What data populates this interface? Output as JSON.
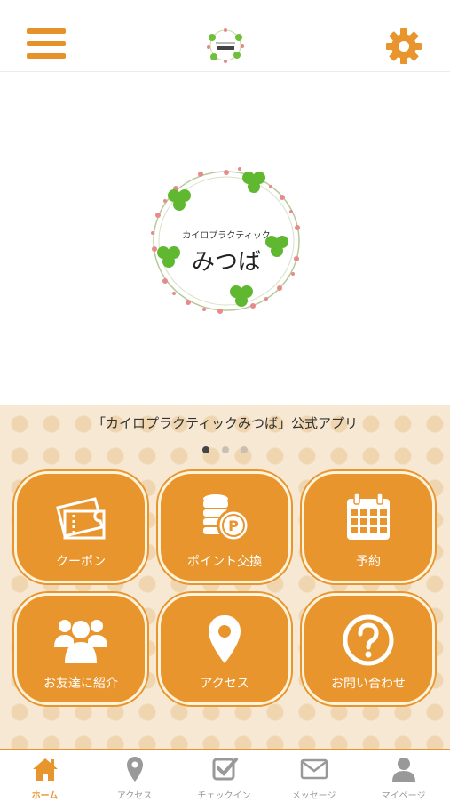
{
  "header": {
    "menu_icon": "hamburger-menu-icon",
    "settings_icon": "gear-icon",
    "brand_color": "#e8952e"
  },
  "hero": {
    "subtitle": "カイロプラクティック",
    "title": "みつば"
  },
  "panel": {
    "title": "「カイロプラクティックみつば」公式アプリ",
    "carousel_pages": 3,
    "carousel_active": 1
  },
  "tiles": [
    {
      "label": "クーポン",
      "icon": "ticket-icon"
    },
    {
      "label": "ポイント交換",
      "icon": "coins-points-icon"
    },
    {
      "label": "予約",
      "icon": "calendar-icon"
    },
    {
      "label": "お友達に紹介",
      "icon": "group-people-icon"
    },
    {
      "label": "アクセス",
      "icon": "map-pin-icon"
    },
    {
      "label": "お問い合わせ",
      "icon": "question-circle-icon"
    }
  ],
  "tabbar": [
    {
      "label": "ホーム",
      "icon": "home-icon",
      "active": true
    },
    {
      "label": "アクセス",
      "icon": "map-pin-icon",
      "active": false
    },
    {
      "label": "チェックイン",
      "icon": "checkin-icon",
      "active": false
    },
    {
      "label": "メッセージ",
      "icon": "envelope-icon",
      "active": false
    },
    {
      "label": "マイページ",
      "icon": "user-icon",
      "active": false
    }
  ]
}
